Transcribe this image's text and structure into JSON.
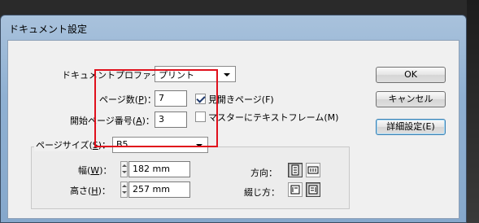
{
  "window": {
    "title": "ドキュメント設定"
  },
  "profile": {
    "label_pre": "ドキュメントプロファイル：",
    "value": "プリント"
  },
  "pages": {
    "label_pre": "ページ数(",
    "key": "P",
    "label_post": ")：",
    "value": "7"
  },
  "start_page": {
    "label_pre": "開始ページ番号(",
    "key": "A",
    "label_post": ")：",
    "value": "3"
  },
  "facing_pages": {
    "label_pre": "見開きページ(F)",
    "checked": true
  },
  "master_text_frame": {
    "label_pre": "マスターにテキストフレーム(M)",
    "checked": false
  },
  "page_size": {
    "label_pre": "ページサイズ(",
    "key": "S",
    "label_post": ")：",
    "value": "B5"
  },
  "width": {
    "label_pre": "幅(",
    "key": "W",
    "label_post": ")：",
    "value": "182 mm"
  },
  "height": {
    "label_pre": "高さ(",
    "key": "H",
    "label_post": ")：",
    "value": "257 mm"
  },
  "orientation": {
    "label": "方向："
  },
  "binding": {
    "label": "綴じ方："
  },
  "buttons": {
    "ok": "OK",
    "cancel": "キャンセル",
    "more": "詳細設定(E)"
  },
  "colors": {
    "highlight": "#e0101c",
    "title_bar": "#a9c2dc"
  }
}
